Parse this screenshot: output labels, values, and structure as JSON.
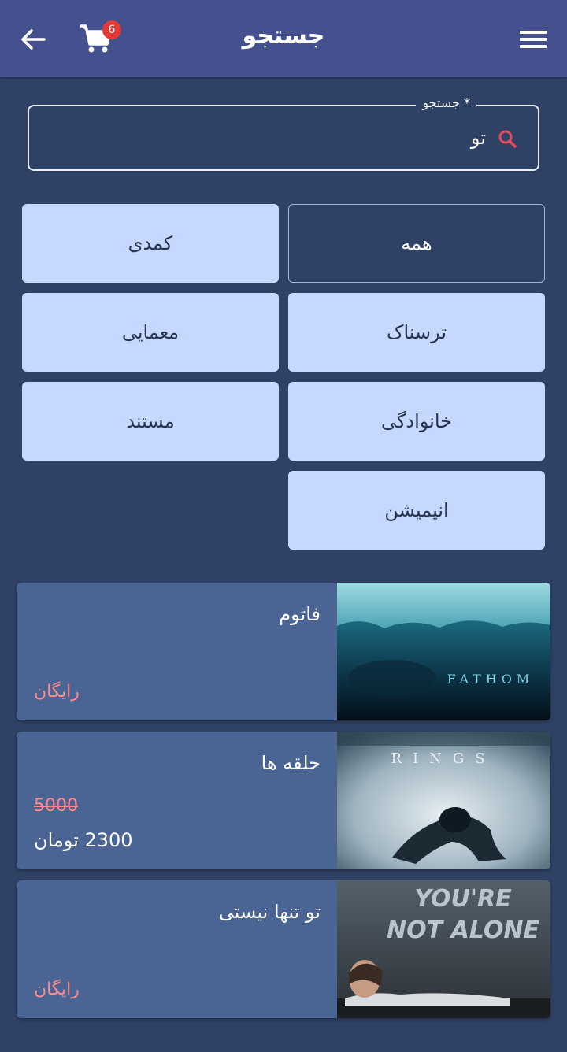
{
  "header": {
    "title": "جستجو",
    "cart_count": "6"
  },
  "search": {
    "label": "جستجو *",
    "value": "تو"
  },
  "categories": [
    {
      "label": "همه",
      "active": true
    },
    {
      "label": "کمدی",
      "active": false
    },
    {
      "label": "ترسناک",
      "active": false
    },
    {
      "label": "معمایی",
      "active": false
    },
    {
      "label": "خانوادگی",
      "active": false
    },
    {
      "label": "مستند",
      "active": false
    },
    {
      "label": "انیمیشن",
      "active": false
    }
  ],
  "movies": [
    {
      "title": "فاتوم",
      "price": "رایگان",
      "poster_text": "FATHOM"
    },
    {
      "title": "حلقه ها",
      "old_price": "5000",
      "price": "2300 تومان",
      "poster_text": "RINGS"
    },
    {
      "title": "تو تنها نیستی",
      "price": "رایگان",
      "poster_text": "YOU'RE NOT ALONE"
    }
  ],
  "colors": {
    "appbar": "#45508f",
    "background": "#2f4266",
    "chip": "#c6d8ff",
    "card": "#4a6493",
    "price_free": "#ff8a8a",
    "badge": "#e53935"
  },
  "icons": [
    "back-arrow-icon",
    "cart-icon",
    "menu-icon",
    "search-icon"
  ]
}
